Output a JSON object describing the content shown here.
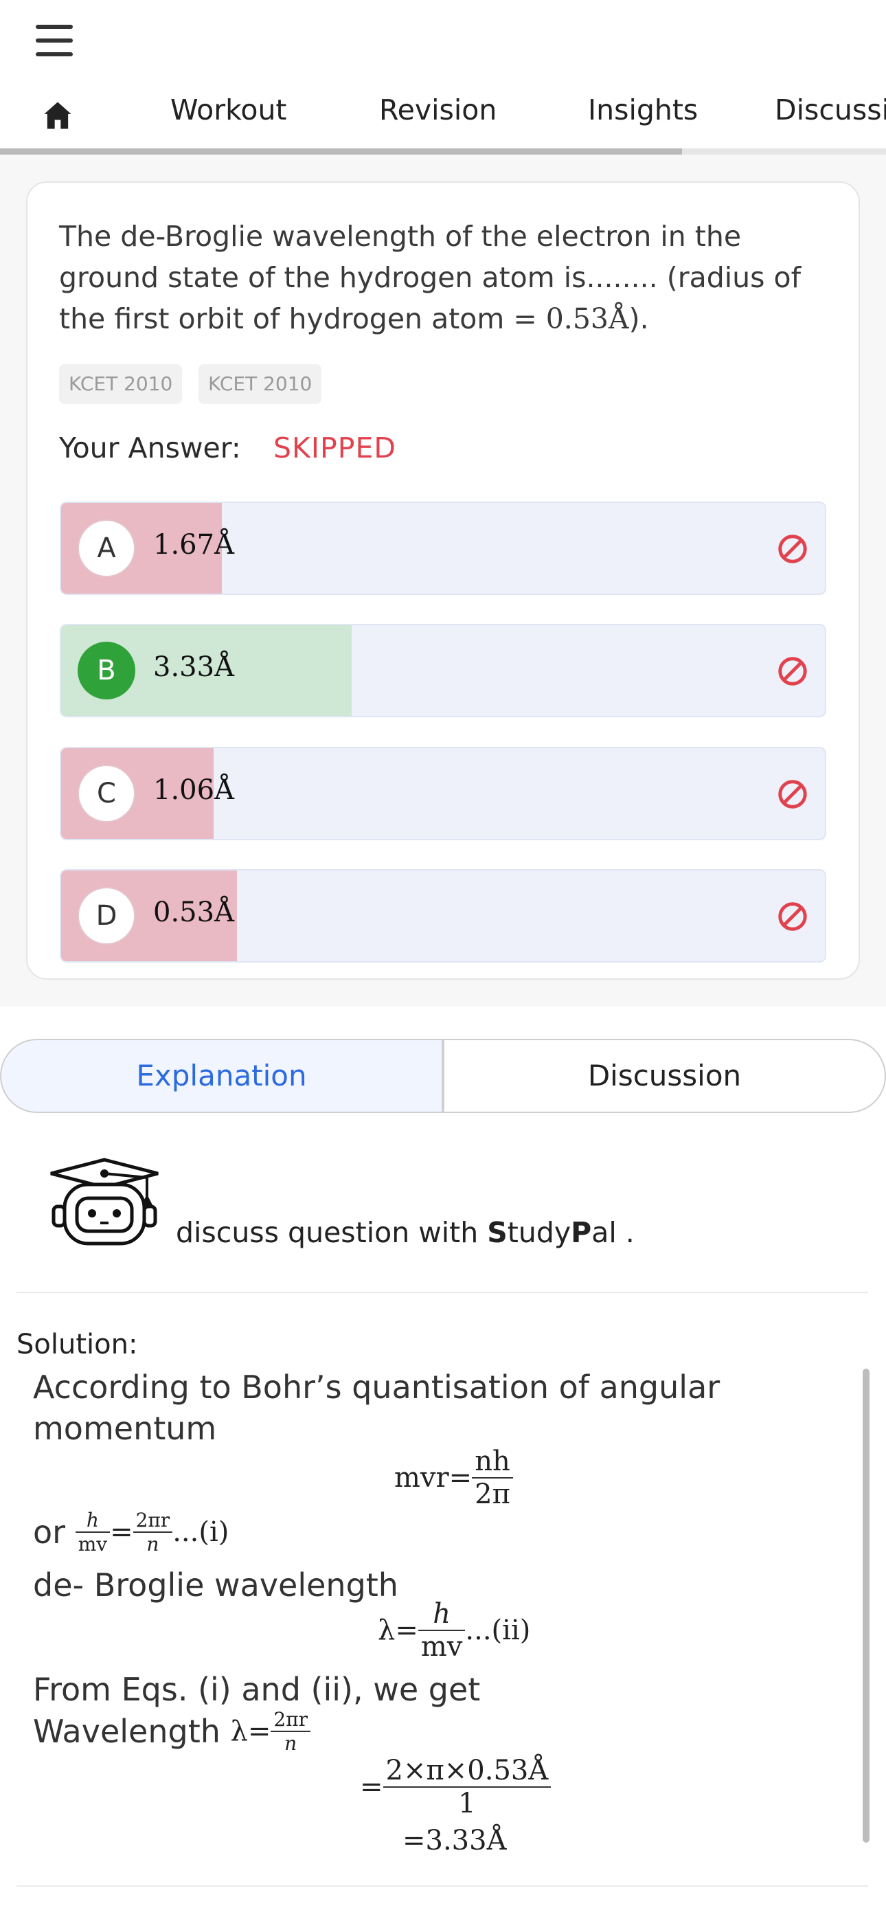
{
  "header": {
    "menu_icon": "hamburger-icon"
  },
  "tabs": {
    "home_icon": "home-icon",
    "items": [
      "Workout",
      "Revision",
      "Insights",
      "Discussi"
    ],
    "progress": 0.77
  },
  "question": {
    "text": "The de-Broglie wavelength of the electron in the ground state of the hydrogen atom is........ (radius of the first orbit of hydrogen atom = ",
    "math": "0.53Å",
    "text_end": ").",
    "tags": [
      "KCET 2010",
      "KCET 2010"
    ],
    "your_answer_label": "Your Answer:",
    "your_answer_value": "SKIPPED"
  },
  "options": [
    {
      "letter": "A",
      "value": "1.67Å",
      "fill": 0.21,
      "correct": false
    },
    {
      "letter": "B",
      "value": "3.33Å",
      "fill": 0.38,
      "correct": true
    },
    {
      "letter": "C",
      "value": "1.06Å",
      "fill": 0.2,
      "correct": false
    },
    {
      "letter": "D",
      "value": "0.53Å",
      "fill": 0.23,
      "correct": false
    }
  ],
  "colors": {
    "wrong_fill": "#e9b9c4",
    "correct_fill": "#cfe7d5",
    "option_bg": "#eef1fa",
    "skipped": "#e0434e",
    "accent": "#2c6ae0"
  },
  "explain_tabs": {
    "explanation": "Explanation",
    "discussion": "Discussion"
  },
  "studypal": {
    "prefix": "discuss question with ",
    "s": "S",
    "tudy": "tudy",
    "p": "P",
    "al": "al ."
  },
  "solution": {
    "title": "Solution:",
    "line1": "According to Bohr’s quantisation of angular",
    "line2": "momentum",
    "eq1_lhs": "mvr=",
    "eq1_num": "nh",
    "eq1_den": "2π",
    "or": "or ",
    "eq2_num1": "h",
    "eq2_den1": "mv",
    "eq2_eq": "=",
    "eq2_num2": "2πr",
    "eq2_den2": "n",
    "eq2_tail": "...(i)",
    "line3": "de- Broglie wavelength",
    "eq3_lhs": "λ=",
    "eq3_num": "h",
    "eq3_den": "mv",
    "eq3_tail": "...(ii)",
    "line4": "From Eqs. (i) and (ii), we get",
    "line5": "Wavelength ",
    "eq4_lhs": "λ=",
    "eq4_num": "2πr",
    "eq4_den": "n",
    "eq5_eq": "=",
    "eq5_num": "2×π×0.53Å",
    "eq5_den": "1",
    "eq6": "=3.33Å"
  }
}
